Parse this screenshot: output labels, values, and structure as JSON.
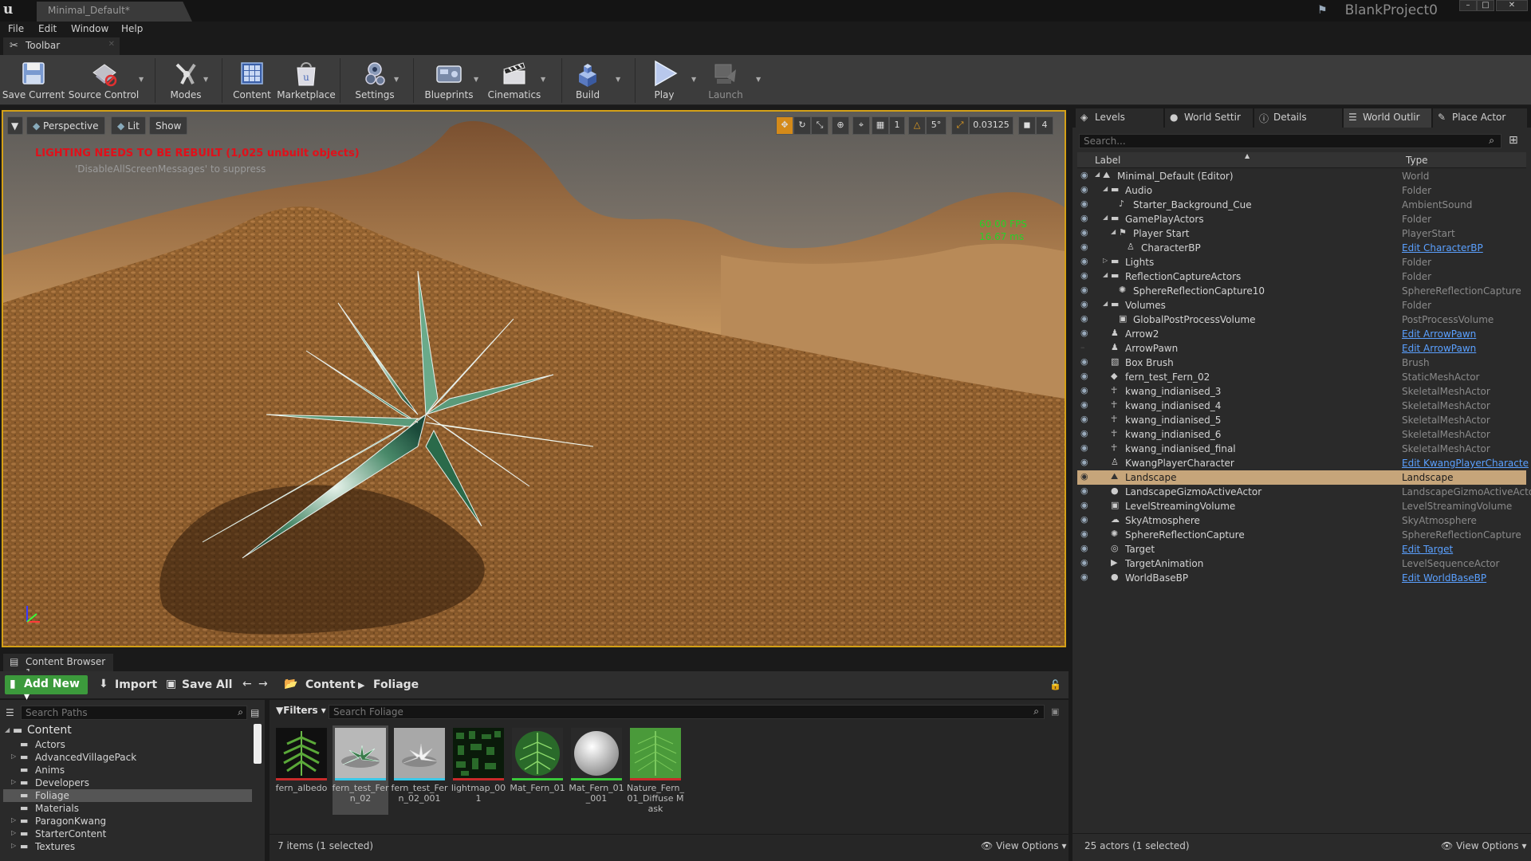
{
  "titlebar": {
    "doc_tab": "Minimal_Default*",
    "project": "BlankProject0",
    "logo": "u"
  },
  "menu": [
    "File",
    "Edit",
    "Window",
    "Help"
  ],
  "toolbar_tab": {
    "label": "Toolbar"
  },
  "toolbar": {
    "save_current": "Save Current",
    "source_control": "Source Control",
    "modes": "Modes",
    "content": "Content",
    "marketplace": "Marketplace",
    "settings": "Settings",
    "blueprints": "Blueprints",
    "cinematics": "Cinematics",
    "build": "Build",
    "play": "Play",
    "launch": "Launch"
  },
  "viewport": {
    "perspective": "Perspective",
    "lit": "Lit",
    "show": "Show",
    "warning": "LIGHTING NEEDS TO BE REBUILT (1,025 unbuilt objects)",
    "suppress": "'DisableAllScreenMessages' to suppress",
    "fps": "60.00 FPS",
    "ms": "16.67 ms",
    "grid_snap": "1",
    "rotation_snap": "5°",
    "scale_snap": "0.03125",
    "camera_speed": "4"
  },
  "right_panel": {
    "tabs": [
      "Levels",
      "World Settir",
      "Details",
      "World Outlir",
      "Place Actor"
    ],
    "search_placeholder": "Search...",
    "col_label": "Label",
    "col_type": "Type",
    "rows": [
      {
        "label": "Minimal_Default (Editor)",
        "type": "World"
      },
      {
        "label": "Audio",
        "type": "Folder"
      },
      {
        "label": "Starter_Background_Cue",
        "type": "AmbientSound"
      },
      {
        "label": "GamePlayActors",
        "type": "Folder"
      },
      {
        "label": "Player Start",
        "type": "PlayerStart"
      },
      {
        "label": "CharacterBP",
        "type": "Edit CharacterBP"
      },
      {
        "label": "Lights",
        "type": "Folder"
      },
      {
        "label": "ReflectionCaptureActors",
        "type": "Folder"
      },
      {
        "label": "SphereReflectionCapture10",
        "type": "SphereReflectionCapture"
      },
      {
        "label": "Volumes",
        "type": "Folder"
      },
      {
        "label": "GlobalPostProcessVolume",
        "type": "PostProcessVolume"
      },
      {
        "label": "Arrow2",
        "type": "Edit ArrowPawn"
      },
      {
        "label": "ArrowPawn",
        "type": "Edit ArrowPawn"
      },
      {
        "label": "Box Brush",
        "type": "Brush"
      },
      {
        "label": "fern_test_Fern_02",
        "type": "StaticMeshActor"
      },
      {
        "label": "kwang_indianised_3",
        "type": "SkeletalMeshActor"
      },
      {
        "label": "kwang_indianised_4",
        "type": "SkeletalMeshActor"
      },
      {
        "label": "kwang_indianised_5",
        "type": "SkeletalMeshActor"
      },
      {
        "label": "kwang_indianised_6",
        "type": "SkeletalMeshActor"
      },
      {
        "label": "kwang_indianised_final",
        "type": "SkeletalMeshActor"
      },
      {
        "label": "KwangPlayerCharacter",
        "type": "Edit KwangPlayerCharacte"
      },
      {
        "label": "Landscape",
        "type": "Landscape"
      },
      {
        "label": "LandscapeGizmoActiveActor",
        "type": "LandscapeGizmoActiveActor"
      },
      {
        "label": "LevelStreamingVolume",
        "type": "LevelStreamingVolume"
      },
      {
        "label": "SkyAtmosphere",
        "type": "SkyAtmosphere"
      },
      {
        "label": "SphereReflectionCapture",
        "type": "SphereReflectionCapture"
      },
      {
        "label": "Target",
        "type": "Edit Target"
      },
      {
        "label": "TargetAnimation",
        "type": "LevelSequenceActor"
      },
      {
        "label": "WorldBaseBP",
        "type": "Edit WorldBaseBP"
      }
    ],
    "status": "25 actors (1 selected)",
    "view_options": "View Options"
  },
  "content_browser": {
    "tab": "Content Browser 1",
    "add_new": "Add New",
    "import": "Import",
    "save_all": "Save All",
    "crumb_root": "Content",
    "crumb_current": "Foliage",
    "paths_placeholder": "Search Paths",
    "tree_root": "Content",
    "tree": [
      "Actors",
      "AdvancedVillagePack",
      "Anims",
      "Developers",
      "Foliage",
      "Materials",
      "ParagonKwang",
      "StarterContent",
      "Textures"
    ],
    "filters": "Filters",
    "search_placeholder": "Search Foliage",
    "assets": [
      "fern_albedo",
      "fern_test_Fern_02",
      "fern_test_Fern_02_001",
      "lightmap_001",
      "Mat_Fern_01",
      "Mat_Fern_01_001",
      "Nature_Fern_01_Diffuse Mask"
    ],
    "status": "7 items (1 selected)",
    "view_options": "View Options"
  }
}
